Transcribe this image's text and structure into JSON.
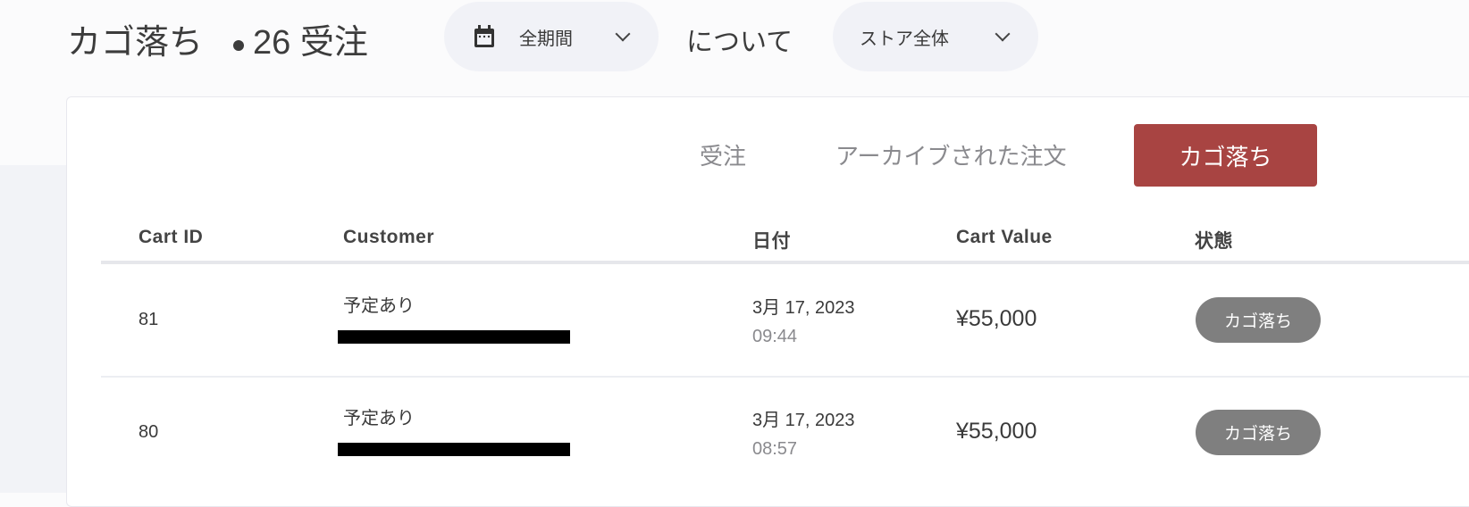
{
  "header": {
    "title": "カゴ落ち",
    "count": "26 受注",
    "period": "全期間",
    "about": "について",
    "scope": "ストア全体"
  },
  "tabs": {
    "orders": "受注",
    "archived": "アーカイブされた注文",
    "abandoned": "カゴ落ち"
  },
  "table": {
    "columns": [
      "Cart ID",
      "Customer",
      "日付",
      "Cart Value",
      "状態"
    ],
    "rows": [
      {
        "id": "81",
        "customer": "予定あり",
        "date": "3月 17, 2023",
        "time": "09:44",
        "value": "¥55,000",
        "status": "カゴ落ち"
      },
      {
        "id": "80",
        "customer": "予定あり",
        "date": "3月 17, 2023",
        "time": "08:57",
        "value": "¥55,000",
        "status": "カゴ落ち"
      }
    ]
  },
  "colors": {
    "accent": "#a84442",
    "badge": "#7f7f7f"
  }
}
